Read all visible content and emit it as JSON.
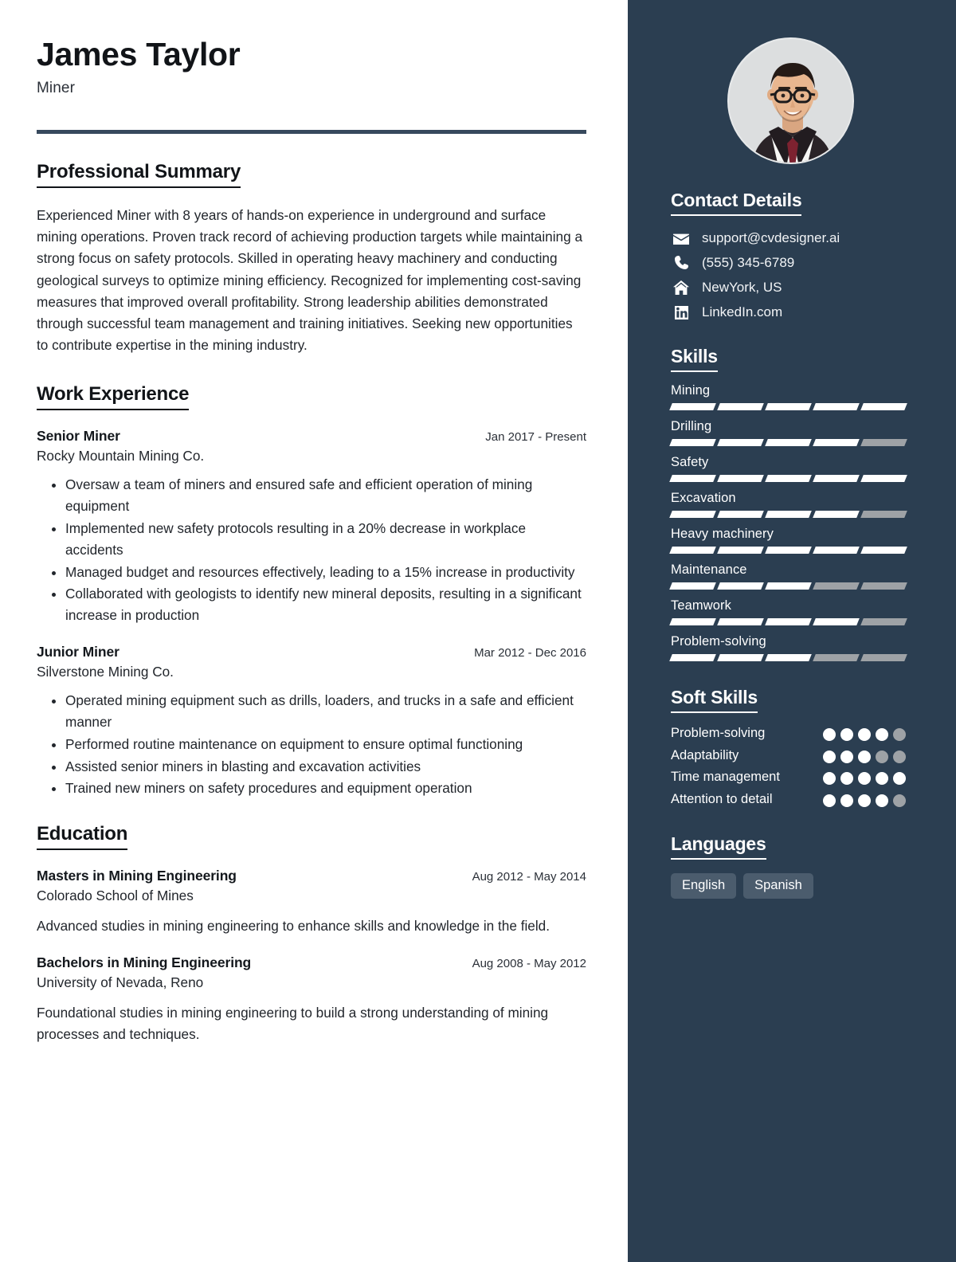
{
  "header": {
    "name": "James Taylor",
    "role": "Miner"
  },
  "avatar": {
    "alt": "profile-photo"
  },
  "main": {
    "summary": {
      "title": "Professional Summary",
      "text": "Experienced Miner with 8 years of hands-on experience in underground and surface mining operations. Proven track record of achieving production targets while maintaining a strong focus on safety protocols. Skilled in operating heavy machinery and conducting geological surveys to optimize mining efficiency. Recognized for implementing cost-saving measures that improved overall profitability. Strong leadership abilities demonstrated through successful team management and training initiatives. Seeking new opportunities to contribute expertise in the mining industry."
    },
    "work": {
      "title": "Work Experience",
      "entries": [
        {
          "position": "Senior Miner",
          "dates": "Jan 2017 - Present",
          "company": "Rocky Mountain Mining Co.",
          "bullets": [
            "Oversaw a team of miners and ensured safe and efficient operation of mining equipment",
            "Implemented new safety protocols resulting in a 20% decrease in workplace accidents",
            "Managed budget and resources effectively, leading to a 15% increase in productivity",
            "Collaborated with geologists to identify new mineral deposits, resulting in a significant increase in production"
          ]
        },
        {
          "position": "Junior Miner",
          "dates": "Mar 2012 - Dec 2016",
          "company": "Silverstone Mining Co.",
          "bullets": [
            "Operated mining equipment such as drills, loaders, and trucks in a safe and efficient manner",
            "Performed routine maintenance on equipment to ensure optimal functioning",
            "Assisted senior miners in blasting and excavation activities",
            "Trained new miners on safety procedures and equipment operation"
          ]
        }
      ]
    },
    "education": {
      "title": "Education",
      "entries": [
        {
          "degree": "Masters in Mining Engineering",
          "dates": "Aug 2012 - May 2014",
          "school": "Colorado School of Mines",
          "description": "Advanced studies in mining engineering to enhance skills and knowledge in the field."
        },
        {
          "degree": "Bachelors in Mining Engineering",
          "dates": "Aug 2008 - May 2012",
          "school": "University of Nevada, Reno",
          "description": "Foundational studies in mining engineering to build a strong understanding of mining processes and techniques."
        }
      ]
    }
  },
  "sidebar": {
    "contact": {
      "title": "Contact Details",
      "items": [
        {
          "icon": "envelope-icon",
          "value": "support@cvdesigner.ai"
        },
        {
          "icon": "phone-icon",
          "value": "(555) 345-6789"
        },
        {
          "icon": "home-icon",
          "value": "NewYork, US"
        },
        {
          "icon": "linkedin-icon",
          "value": "LinkedIn.com"
        }
      ]
    },
    "skills": {
      "title": "Skills",
      "max": 5,
      "items": [
        {
          "name": "Mining",
          "level": 5
        },
        {
          "name": "Drilling",
          "level": 4
        },
        {
          "name": "Safety",
          "level": 5
        },
        {
          "name": "Excavation",
          "level": 4
        },
        {
          "name": "Heavy machinery",
          "level": 5
        },
        {
          "name": "Maintenance",
          "level": 3
        },
        {
          "name": "Teamwork",
          "level": 4
        },
        {
          "name": "Problem-solving",
          "level": 3
        }
      ]
    },
    "soft_skills": {
      "title": "Soft Skills",
      "max": 5,
      "items": [
        {
          "name": "Problem-solving",
          "level": 4
        },
        {
          "name": "Adaptability",
          "level": 3
        },
        {
          "name": "Time management",
          "level": 5
        },
        {
          "name": "Attention to detail",
          "level": 4
        }
      ]
    },
    "languages": {
      "title": "Languages",
      "items": [
        "English",
        "Spanish"
      ]
    }
  },
  "colors": {
    "sidebar_bg": "#2b3e51",
    "rule": "#37495d",
    "chip_bg": "#4b5c6d",
    "filled": "#ffffff",
    "empty": "#9ea2a6",
    "text_dark": "#22262c"
  }
}
